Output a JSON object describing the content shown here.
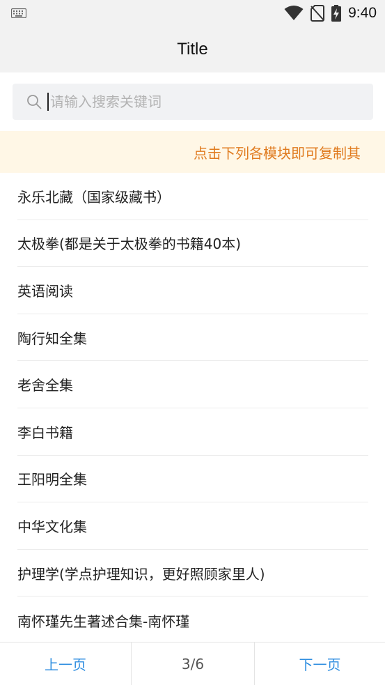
{
  "status_bar": {
    "time": "9:40",
    "icons": [
      "keyboard-icon",
      "wifi-icon",
      "no-sim-icon",
      "battery-charging-icon"
    ]
  },
  "app_bar": {
    "title": "Title"
  },
  "search": {
    "placeholder": "请输入搜索关键词",
    "value": ""
  },
  "notice": {
    "text": "点击下列各模块即可复制其"
  },
  "list": {
    "items": [
      "永乐北藏（国家级藏书）",
      "太极拳(都是关于太极拳的书籍40本)",
      "英语阅读",
      "陶行知全集",
      "老舍全集",
      "李白书籍",
      "王阳明全集",
      "中华文化集",
      "护理学(学点护理知识，更好照顾家里人)",
      "南怀瑾先生著述合集-南怀瑾"
    ]
  },
  "pager": {
    "prev_label": "上一页",
    "indicator": "3/6",
    "next_label": "下一页"
  },
  "colors": {
    "accent": "#2f8ee0",
    "notice_text": "#e07b1f",
    "notice_bg": "#fff7e6"
  }
}
